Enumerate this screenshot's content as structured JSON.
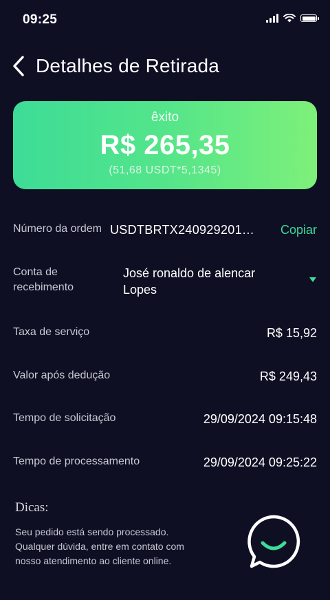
{
  "status_bar": {
    "time": "09:25",
    "icons": [
      "cellular-signal-icon",
      "wifi-icon",
      "battery-icon"
    ]
  },
  "header": {
    "back_icon": "chevron-left-icon",
    "title": "Detalhes de Retirada"
  },
  "amount_card": {
    "status": "êxito",
    "amount": "R$ 265,35",
    "conversion": "(51,68 USDT*5,1345)",
    "gradient": [
      "#3ddc97",
      "#7ef07a"
    ]
  },
  "details": {
    "order_number": {
      "label": "Número da ordem",
      "value": "USDTBRTX240929201…",
      "copy_label": "Copiar"
    },
    "receiving_account": {
      "label_line1": "Conta de",
      "label_line2": "recebimento",
      "value": "José ronaldo de alencar Lopes",
      "dropdown_icon": "caret-down-icon"
    },
    "service_fee": {
      "label": "Taxa de serviço",
      "value": "R$ 15,92"
    },
    "value_after_deduction": {
      "label": "Valor após dedução",
      "value": "R$ 249,43"
    },
    "request_time": {
      "label": "Tempo de solicitação",
      "value": "29/09/2024 09:15:48"
    },
    "processing_time": {
      "label": "Tempo de processamento",
      "value": "29/09/2024 09:25:22"
    }
  },
  "tips": {
    "title": "Dicas:",
    "line1": "Seu pedido está sendo processado.",
    "line2": "Qualquer dúvida, entre em contato com",
    "line3": "nosso atendimento ao cliente online."
  },
  "chat_button": {
    "icon": "smiley-chat-bubble-icon"
  },
  "colors": {
    "background": "#0f0f24",
    "accent": "#3ddc97",
    "label": "#c7c8d2",
    "text": "#ffffff"
  }
}
